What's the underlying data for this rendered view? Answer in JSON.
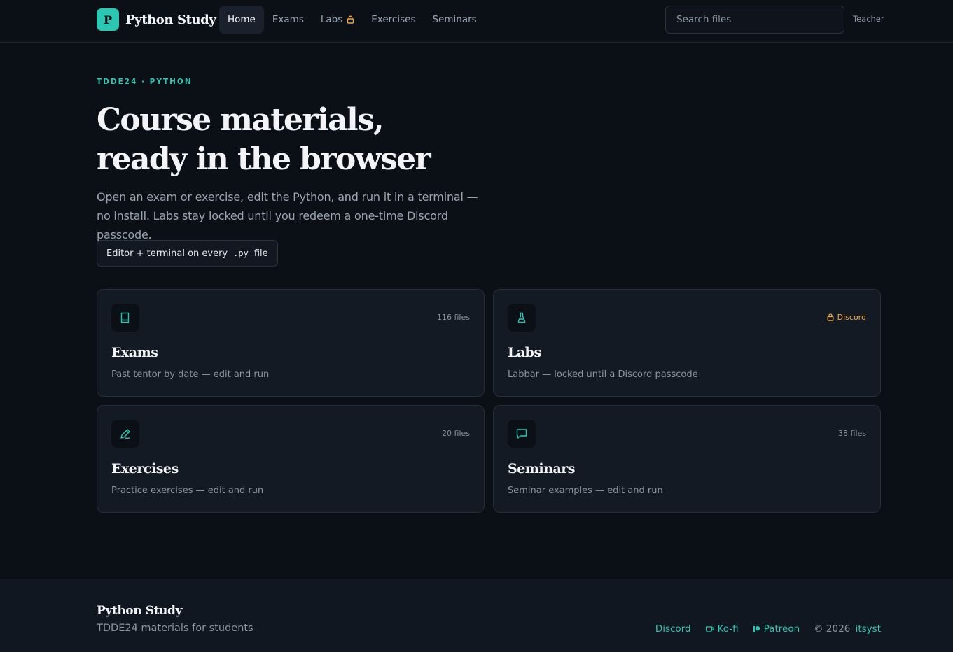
{
  "header": {
    "brand_initial": "P",
    "brand_name": "Python Study",
    "nav": [
      {
        "label": "Home"
      },
      {
        "label": "Exams"
      },
      {
        "label": "Labs"
      },
      {
        "label": "Exercises"
      },
      {
        "label": "Seminars"
      }
    ],
    "search_placeholder": "Search files",
    "role_label": "Teacher"
  },
  "hero": {
    "eyebrow": "TDDE24 · PYTHON",
    "headline_line1": "Course materials,",
    "headline_line2": "ready in the browser",
    "lede": "Open an exam or exercise, edit the Python, and run it in a terminal — no install. Labs stay locked until you redeem a one-time Discord passcode.",
    "pill_prefix": "Editor + terminal on every",
    "pill_code": ".py",
    "pill_suffix": "file"
  },
  "cards": [
    {
      "icon": "book-icon",
      "meta": "116 files",
      "title": "Exams",
      "desc": "Past tentor by date — edit and run"
    },
    {
      "icon": "flask-icon",
      "meta": "Discord",
      "title": "Labs",
      "desc": "Labbar — locked until a Discord passcode"
    },
    {
      "icon": "pencil-icon",
      "meta": "20 files",
      "title": "Exercises",
      "desc": "Practice exercises — edit and run"
    },
    {
      "icon": "chat-icon",
      "meta": "38 files",
      "title": "Seminars",
      "desc": "Seminar examples — edit and run"
    }
  ],
  "footer": {
    "brand": "Python Study",
    "tagline": "TDDE24 materials for students",
    "links": [
      {
        "label": "Discord"
      },
      {
        "label": "Ko-fi",
        "icon": "coffee-icon"
      },
      {
        "label": "Patreon",
        "icon": "patreon-icon"
      }
    ],
    "copyright": "© 2026",
    "author": "itsyst"
  },
  "colors": {
    "accent": "#2cc7b3",
    "locked": "#f0a94a",
    "background": "#0b0f16",
    "card": "#141a23"
  }
}
